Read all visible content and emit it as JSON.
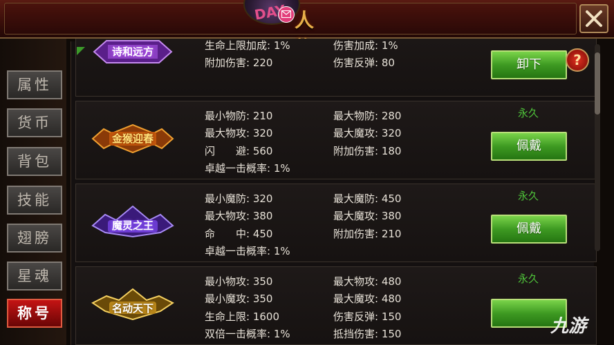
{
  "header": {
    "title": "人 物",
    "logo_text": "DAY"
  },
  "sidebar": {
    "tabs": [
      {
        "label": "属性",
        "active": false
      },
      {
        "label": "货币",
        "active": false
      },
      {
        "label": "背包",
        "active": false
      },
      {
        "label": "技能",
        "active": false
      },
      {
        "label": "翅膀",
        "active": false
      },
      {
        "label": "星魂",
        "active": false
      },
      {
        "label": "称号",
        "active": true
      }
    ]
  },
  "titles": [
    {
      "badge": "诗和远方",
      "stats": [
        [
          "生命上限加成: 1%",
          "伤害加成: 1%"
        ],
        [
          "附加伤害: 220",
          "伤害反弹: 80"
        ]
      ],
      "duration": "",
      "action": "卸下"
    },
    {
      "badge": "金猴迎春",
      "stats": [
        [
          "最小物防: 210",
          "最大物防: 280"
        ],
        [
          "最大物攻: 320",
          "最大魔攻: 320"
        ],
        [
          "闪　　避: 560",
          "附加伤害: 180"
        ],
        [
          "卓越一击概率: 1%",
          ""
        ]
      ],
      "duration": "永久",
      "action": "佩戴"
    },
    {
      "badge": "魔灵之王",
      "stats": [
        [
          "最小魔防: 320",
          "最大魔防: 450"
        ],
        [
          "最大物攻: 380",
          "最大魔攻: 380"
        ],
        [
          "命　　中: 450",
          "附加伤害: 210"
        ],
        [
          "卓越一击概率: 1%",
          ""
        ]
      ],
      "duration": "永久",
      "action": "佩戴"
    },
    {
      "badge": "名动天下",
      "stats": [
        [
          "最小物攻: 350",
          "最大物攻: 480"
        ],
        [
          "最小魔攻: 350",
          "最大魔攻: 480"
        ],
        [
          "生命上限: 1600",
          "伤害反弹: 150"
        ],
        [
          "双倍一击概率: 1%",
          "抵挡伤害: 150"
        ]
      ],
      "duration": "永久",
      "action": ""
    }
  ],
  "help": {
    "label": "?"
  },
  "watermark": "九游",
  "colors": {
    "accent_gold": "#e8b04a",
    "button_green": "#3e9a22",
    "duration_green": "#4fc43a",
    "active_tab_red": "#c41414"
  }
}
